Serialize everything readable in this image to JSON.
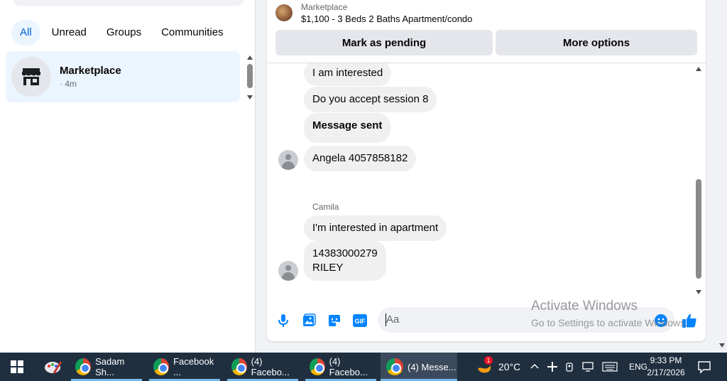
{
  "sidebar": {
    "filters": [
      {
        "label": "All",
        "active": true
      },
      {
        "label": "Unread",
        "active": false
      },
      {
        "label": "Groups",
        "active": false
      },
      {
        "label": "Communities",
        "active": false
      }
    ],
    "conversation": {
      "name": "Marketplace",
      "time": "· 4m",
      "icon": "storefront-icon"
    }
  },
  "chat": {
    "listing": {
      "category": "Marketplace",
      "title": "$1,100 - 3 Beds 2 Baths Apartment/condo"
    },
    "actions": {
      "pending": "Mark as pending",
      "more": "More options"
    },
    "messages": [
      {
        "text": "I am interested"
      },
      {
        "text": "Do you accept session 8"
      },
      {
        "text": "Message sent",
        "bold": true
      },
      {
        "text": "Angela 4057858182"
      },
      {
        "sender": "Camila"
      },
      {
        "text": "I'm interested in apartment"
      },
      {
        "line1": "14383000279",
        "line2": "RILEY"
      }
    ],
    "composer": {
      "placeholder": "Aa",
      "icons": [
        "microphone-icon",
        "photo-icon",
        "sticker-icon",
        "gif-icon",
        "emoji-icon",
        "thumbs-up-icon"
      ],
      "gif_label": "GIF"
    }
  },
  "watermark": {
    "line1": "Activate Windows",
    "line2": "Go to Settings to activate Windows."
  },
  "taskbar": {
    "apps": [
      {
        "label": "Sadam Sh..."
      },
      {
        "label": "Facebook ..."
      },
      {
        "label": "(4) Facebo..."
      },
      {
        "label": "(4) Facebo..."
      },
      {
        "label": "(4) Messe..."
      }
    ],
    "weather": {
      "temp": "20°C",
      "badge": "1"
    },
    "language": "ENG",
    "time": "9:33 PM",
    "date": "2/17/2026"
  },
  "colors": {
    "accent": "#0064d1",
    "messenger_blue": "#0084ff",
    "taskbar": "#1f2f40"
  }
}
